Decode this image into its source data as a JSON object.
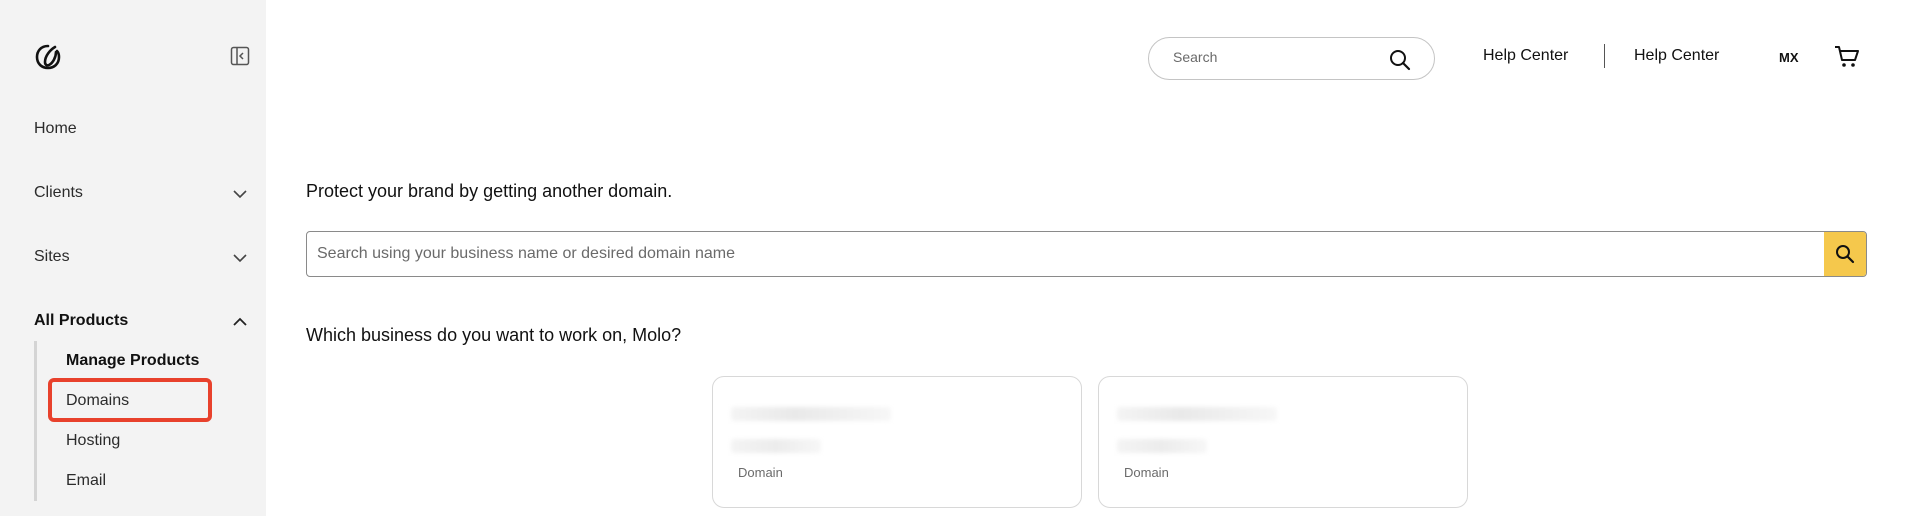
{
  "sidebar": {
    "nav": [
      {
        "label": "Home"
      },
      {
        "label": "Clients"
      },
      {
        "label": "Sites"
      },
      {
        "label": "All Products"
      }
    ],
    "sub_items": [
      {
        "label": "Manage Products"
      },
      {
        "label": "Domains"
      },
      {
        "label": "Hosting"
      },
      {
        "label": "Email"
      }
    ]
  },
  "header": {
    "search_placeholder": "Search",
    "links": [
      "Help Center",
      "Help Center"
    ],
    "locale": "MX"
  },
  "main": {
    "protect_heading": "Protect your brand by getting another domain.",
    "domain_search_placeholder": "Search using your business name or desired domain name",
    "business_heading": "Which business do you want to work on, Molo?",
    "cards": [
      {
        "type": "Domain"
      },
      {
        "type": "Domain"
      }
    ]
  },
  "colors": {
    "accent_yellow": "#f5c84c",
    "highlight_red": "#e8412c",
    "sidebar_bg": "#f3f3f3"
  }
}
